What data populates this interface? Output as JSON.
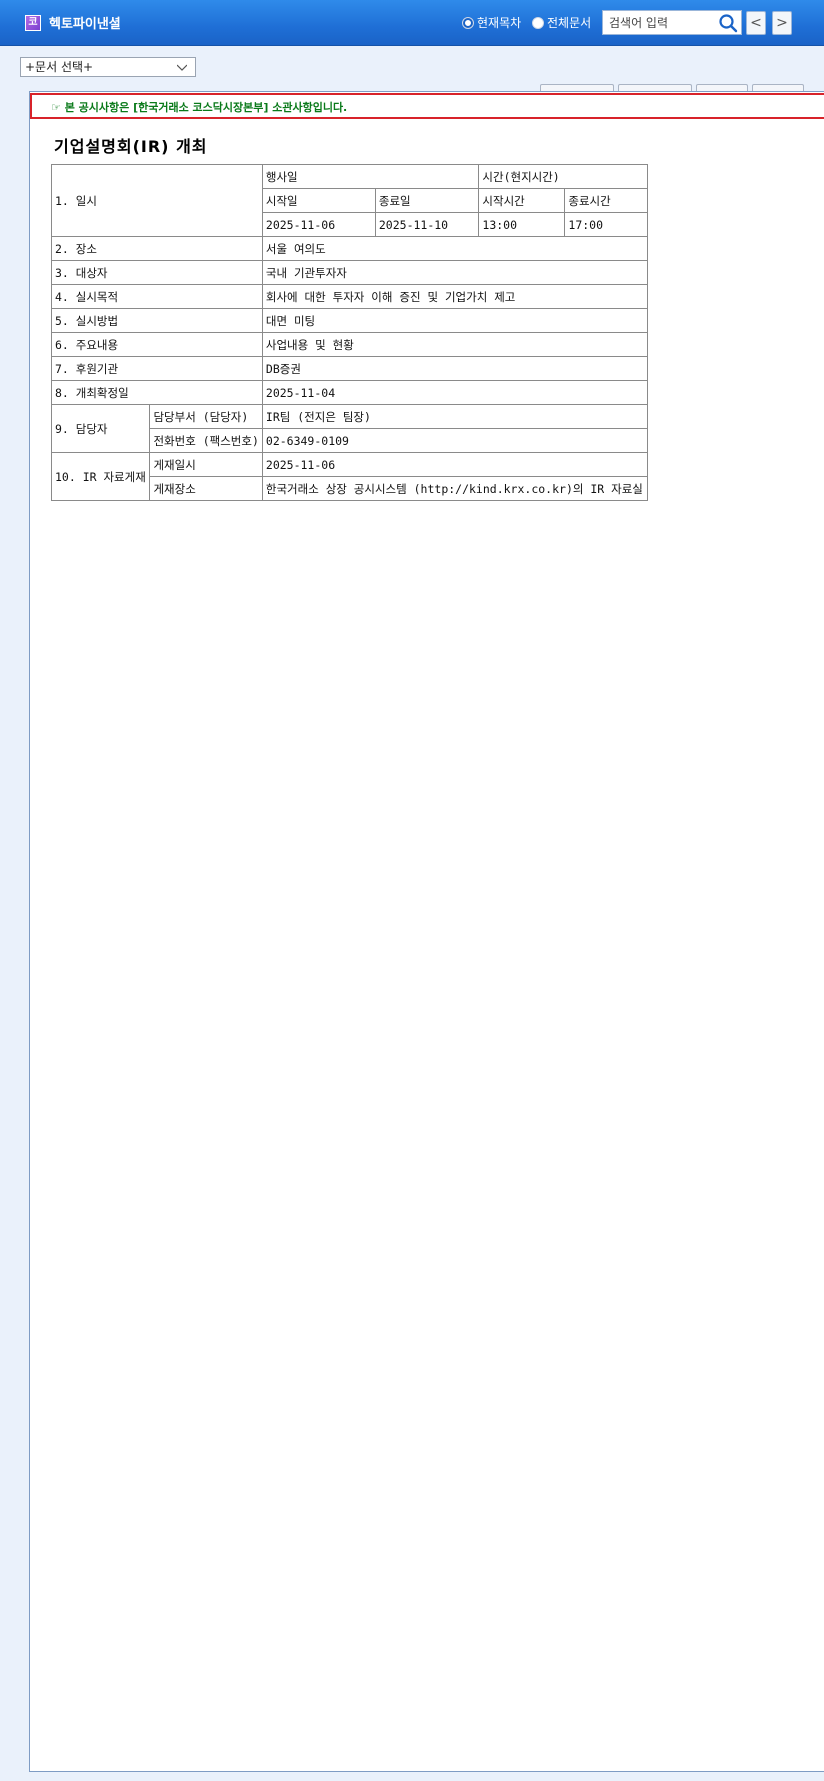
{
  "header": {
    "logo_char": "코",
    "company": "헥토파이낸셜",
    "radio_current": "현재목차",
    "radio_all": "전체문서",
    "search_placeholder": "검색어 입력",
    "prev": "<",
    "next": ">"
  },
  "doc_select": {
    "label": "+문서 선택+"
  },
  "notice": {
    "text": "☞ 본 공시사항은 [한국거래소 코스닥시장본부] 소관사항입니다."
  },
  "document": {
    "title": "기업설명회(IR) 개최",
    "rows": {
      "r1_label": "1. 일시",
      "event_date": "행사일",
      "time_local": "시간(현지시간)",
      "start_date_h": "시작일",
      "end_date_h": "종료일",
      "start_time_h": "시작시간",
      "end_time_h": "종료시간",
      "start_date": "2025-11-06",
      "end_date": "2025-11-10",
      "start_time": "13:00",
      "end_time": "17:00",
      "r2_label": "2. 장소",
      "r2_value": "서울 여의도",
      "r3_label": "3. 대상자",
      "r3_value": "국내 기관투자자",
      "r4_label": "4. 실시목적",
      "r4_value": "회사에 대한 투자자 이해 증진 및 기업가치 제고",
      "r5_label": "5. 실시방법",
      "r5_value": "대면 미팅",
      "r6_label": "6. 주요내용",
      "r6_value": "사업내용 및 현황",
      "r7_label": "7. 후원기관",
      "r7_value": "DB증권",
      "r8_label": "8. 개최확정일",
      "r8_value": "2025-11-04",
      "r9_label": "9. 담당자",
      "r9_dept_h": "담당부서 (담당자)",
      "r9_dept_value": "IR팀 (전지은 팀장)",
      "r9_phone_h": "전화번호 (팩스번호)",
      "r9_phone_value": "02-6349-0109",
      "r10_label": "10. IR 자료게재",
      "r10_date_h": "게재일시",
      "r10_date_value": "2025-11-06",
      "r10_place_h": "게재장소",
      "r10_place_value": "한국거래소 상장 공시시스템 (http://kind.krx.co.kr)의 IR 자료실"
    }
  }
}
